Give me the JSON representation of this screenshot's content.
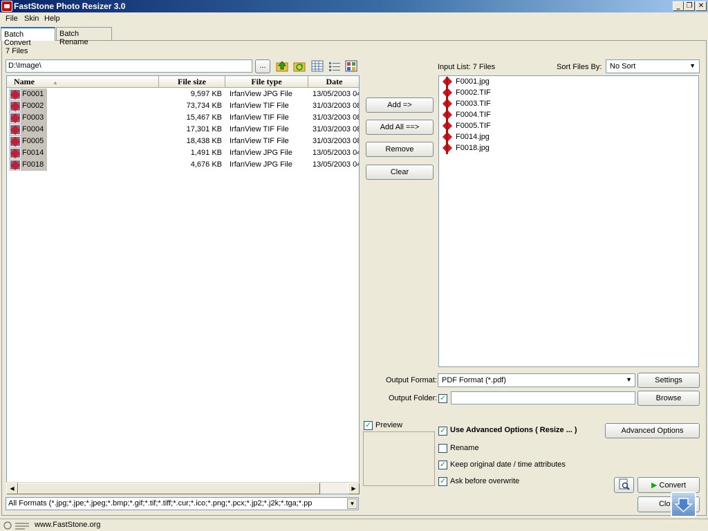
{
  "window": {
    "title": "FastStone Photo Resizer 3.0",
    "controls": {
      "minimize": "_",
      "maximize": "❐",
      "close": "✕"
    }
  },
  "menu": {
    "items": [
      "File",
      "Skin",
      "Help"
    ]
  },
  "tabs": [
    {
      "label": "Batch Convert",
      "active": true
    },
    {
      "label": "Batch Rename",
      "active": false
    }
  ],
  "file_browser": {
    "file_count": "7 Files",
    "path": "D:\\Image\\",
    "browse_label": "...",
    "columns": [
      "Name",
      "File size",
      "File type",
      "Date"
    ],
    "files": [
      {
        "name": "F0001",
        "size": "9,597 KB",
        "type": "IrfanView JPG File",
        "date": "13/05/2003 04"
      },
      {
        "name": "F0002",
        "size": "73,734 KB",
        "type": "IrfanView TIF File",
        "date": "31/03/2003 08"
      },
      {
        "name": "F0003",
        "size": "15,467 KB",
        "type": "IrfanView TIF File",
        "date": "31/03/2003 08"
      },
      {
        "name": "F0004",
        "size": "17,301 KB",
        "type": "IrfanView TIF File",
        "date": "31/03/2003 08"
      },
      {
        "name": "F0005",
        "size": "18,438 KB",
        "type": "IrfanView TIF File",
        "date": "31/03/2003 08"
      },
      {
        "name": "F0014",
        "size": "1,491 KB",
        "type": "IrfanView JPG File",
        "date": "13/05/2003 04"
      },
      {
        "name": "F0018",
        "size": "4,676 KB",
        "type": "IrfanView JPG File",
        "date": "13/05/2003 04"
      }
    ],
    "filter": "All Formats (*.jpg;*.jpe;*.jpeg;*.bmp;*.gif;*.tif;*.tiff;*.cur;*.ico;*.png;*.pcx;*.jp2;*.j2k;*.tga;*.pp"
  },
  "actions": {
    "add": "Add =>",
    "add_all": "Add All ==>",
    "remove": "Remove",
    "clear": "Clear"
  },
  "input_list": {
    "label": "Input List:  7 Files",
    "sort_label": "Sort Files By:",
    "sort_value": "No Sort",
    "items": [
      "F0001.jpg",
      "F0002.TIF",
      "F0003.TIF",
      "F0004.TIF",
      "F0005.TIF",
      "F0014.jpg",
      "F0018.jpg"
    ]
  },
  "output": {
    "format_label": "Output Format:",
    "format_value": "PDF Format (*.pdf)",
    "settings": "Settings",
    "folder_label": "Output Folder:",
    "folder_value": "",
    "browse": "Browse"
  },
  "options": {
    "preview": "Preview",
    "use_advanced": "Use Advanced Options ( Resize ... )",
    "advanced_button": "Advanced Options",
    "rename": "Rename",
    "keep_date": "Keep original date / time attributes",
    "ask_overwrite": "Ask before overwrite"
  },
  "footer": {
    "convert": "Convert",
    "close": "Close",
    "website": "www.FastStone.org"
  },
  "colors": {
    "title_start": "#0a246a",
    "title_end": "#a6caf0",
    "face": "#ece9d8",
    "accent": "#316ac5"
  }
}
